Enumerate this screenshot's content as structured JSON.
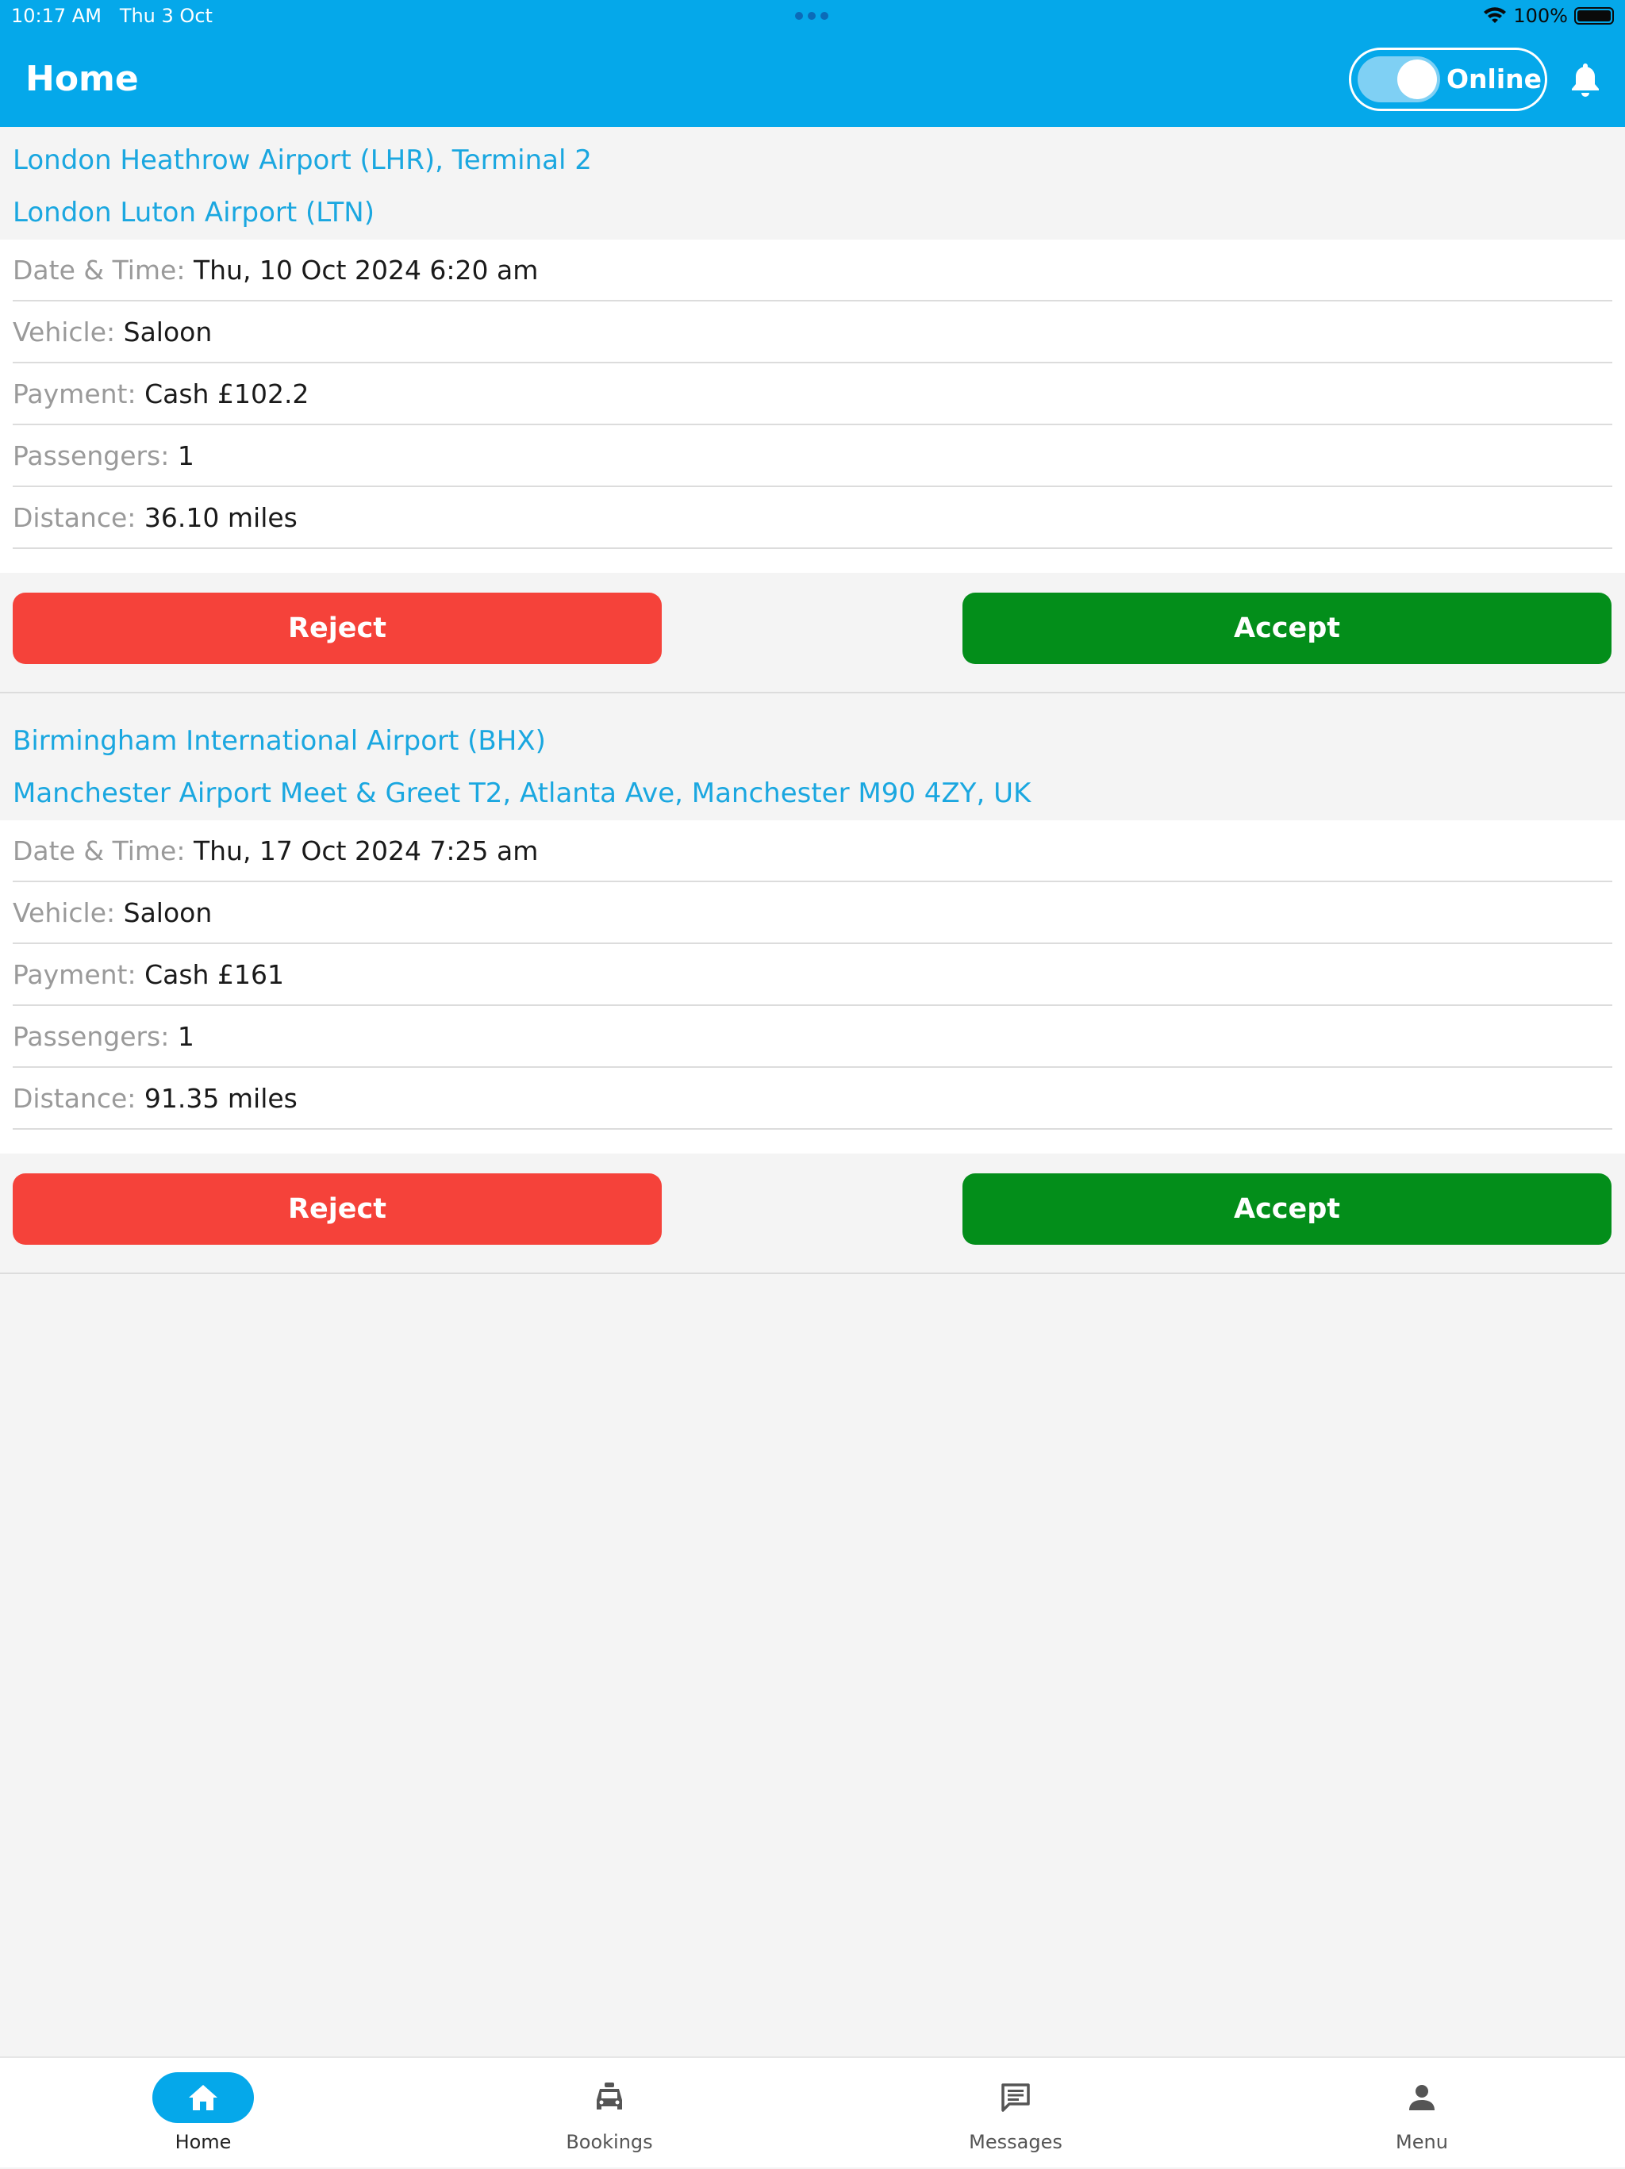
{
  "status_bar": {
    "time": "10:17 AM",
    "date": "Thu 3 Oct",
    "battery": "100%"
  },
  "header": {
    "title": "Home",
    "toggle_label": "Online",
    "toggle_on": true,
    "color": "#05a8ea"
  },
  "bookings": [
    {
      "pickup": "London Heathrow Airport (LHR), Terminal 2",
      "dropoff": "London Luton Airport (LTN)",
      "details": [
        {
          "label": "Date & Time:",
          "value": "Thu, 10 Oct 2024 6:20 am"
        },
        {
          "label": "Vehicle:",
          "value": "Saloon"
        },
        {
          "label": "Payment:",
          "value": "Cash £102.2"
        },
        {
          "label": "Passengers:",
          "value": "1"
        },
        {
          "label": "Distance:",
          "value": "36.10 miles"
        }
      ],
      "reject_label": "Reject",
      "accept_label": "Accept"
    },
    {
      "pickup": "Birmingham International Airport (BHX)",
      "dropoff": "Manchester Airport Meet & Greet T2, Atlanta Ave, Manchester M90 4ZY, UK",
      "details": [
        {
          "label": "Date & Time:",
          "value": "Thu, 17 Oct 2024 7:25 am"
        },
        {
          "label": "Vehicle:",
          "value": "Saloon"
        },
        {
          "label": "Payment:",
          "value": "Cash £161"
        },
        {
          "label": "Passengers:",
          "value": "1"
        },
        {
          "label": "Distance:",
          "value": "91.35 miles"
        }
      ],
      "reject_label": "Reject",
      "accept_label": "Accept"
    }
  ],
  "tabbar": {
    "tabs": [
      {
        "label": "Home",
        "icon": "home-icon",
        "active": true
      },
      {
        "label": "Bookings",
        "icon": "car-icon",
        "active": false
      },
      {
        "label": "Messages",
        "icon": "message-icon",
        "active": false
      },
      {
        "label": "Menu",
        "icon": "person-icon",
        "active": false
      }
    ]
  },
  "colors": {
    "accent": "#05a8ea",
    "address": "#1aa7e0",
    "reject": "#f5423a",
    "accept": "#038e1a"
  }
}
